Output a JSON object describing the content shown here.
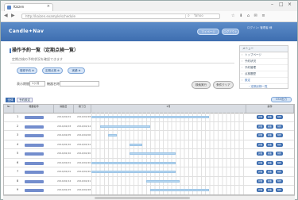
{
  "browser": {
    "tab_title": "Kaizen",
    "tab_close": "×",
    "url": "http://kaizen.example/schedule",
    "search_placeholder": "Yahoo",
    "toolbar_icons": "☆ ⬇ ⌂ ✉ ≡",
    "win_minimize": "–",
    "win_maximize": "□",
    "win_close": "×"
  },
  "header": {
    "logo": "Candle✦Nav",
    "btn1": "マイページ",
    "btn2": "ログアウト",
    "info": "ログイン: 管理者 様"
  },
  "main": {
    "title": "操作予約一覧（定期点検一覧）",
    "subtitle": "定期点検の予約状況を確認できます",
    "actions": [
      "登録予約 ⊕",
      "定期点検 ⊕",
      "実績 ⊕"
    ],
    "filter_label1": "表示期間",
    "filter_select": "1ヶ月",
    "filter_label2": "機器名称",
    "filter_input_placeholder": "",
    "search_btn": "検索実行",
    "clear_btn": "条件クリア"
  },
  "sidebar": {
    "head": "メニュー",
    "items": [
      "トップページ",
      "予約状況",
      "予約管理",
      "点検履歴",
      "設定"
    ],
    "sub": "・定期点検一覧"
  },
  "grid_tabs": [
    "全体",
    "予約設定"
  ],
  "grid_btn": "CSV出力",
  "grid": {
    "headers": [
      "No",
      "機器名称",
      "開始日",
      "終了日",
      "2月",
      "操作"
    ],
    "days": [
      "1",
      "2",
      "3",
      "4",
      "5",
      "6",
      "7",
      "8",
      "9",
      "10",
      "11",
      "12",
      "13",
      "14",
      "15",
      "16",
      "17",
      "18",
      "19",
      "20",
      "21",
      "22",
      "23",
      "24",
      "25",
      "26",
      "27",
      "28",
      "29",
      "30",
      "31",
      "1",
      "2",
      "3",
      "4",
      "5",
      "6"
    ],
    "rows": [
      {
        "no": "1",
        "start": "2014/02/01",
        "end": "2014/02/28"
      },
      {
        "no": "2",
        "start": "2014/02/03",
        "end": "2014/02/14"
      },
      {
        "no": "3",
        "start": "2014/02/05",
        "end": "2014/02/06"
      },
      {
        "no": "4",
        "start": "2014/02/10",
        "end": "2014/02/12"
      },
      {
        "no": "5",
        "start": "2014/02/10",
        "end": "2014/02/20"
      },
      {
        "no": "6",
        "start": "2014/02/01",
        "end": "2014/02/20"
      },
      {
        "no": "7",
        "start": "2014/02/01",
        "end": "2014/02/20"
      },
      {
        "no": "8",
        "start": "2014/02/14",
        "end": "2014/02/21"
      },
      {
        "no": "9",
        "start": "2014/02/15",
        "end": "2014/02/28"
      }
    ],
    "op_labels": [
      "詳細",
      "編集",
      "削除"
    ]
  }
}
